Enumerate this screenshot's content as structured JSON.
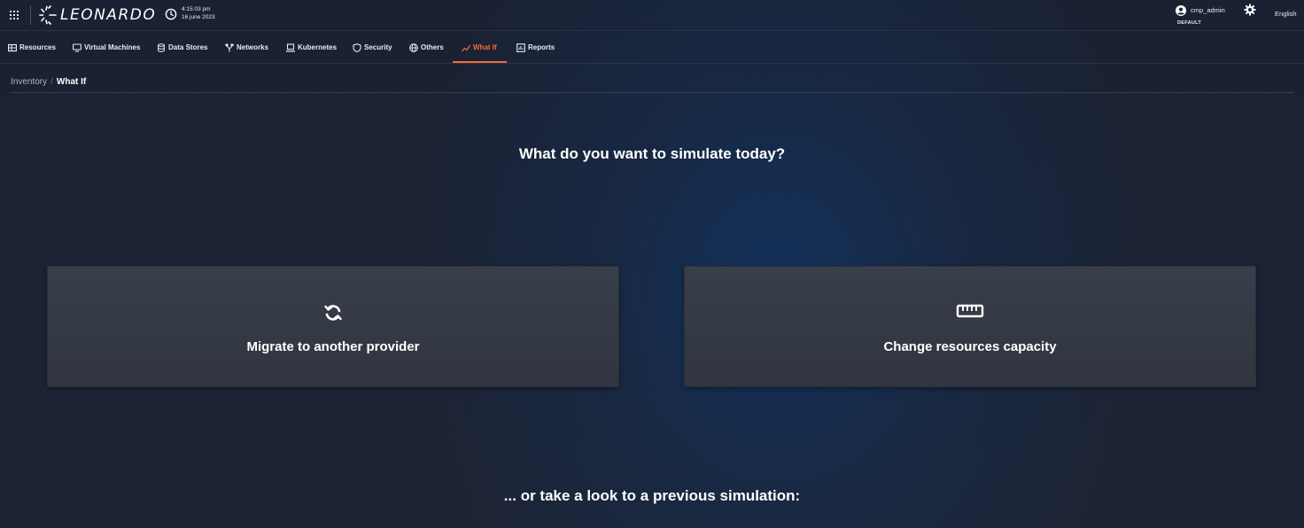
{
  "header": {
    "logo_text": "LEONARDO",
    "time": "4:15:03 pm",
    "date": "16 june 2023",
    "user_name": "cmp_admin",
    "tenant": "DEFAULT",
    "language": "English"
  },
  "nav": {
    "items": [
      {
        "label": "Resources",
        "icon": "server-icon"
      },
      {
        "label": "Virtual Machines",
        "icon": "monitor-icon"
      },
      {
        "label": "Data Stores",
        "icon": "database-icon"
      },
      {
        "label": "Networks",
        "icon": "network-icon"
      },
      {
        "label": "Kubernetes",
        "icon": "laptop-icon"
      },
      {
        "label": "Security",
        "icon": "shield-icon"
      },
      {
        "label": "Others",
        "icon": "globe-icon"
      },
      {
        "label": "What If",
        "icon": "chart-line-icon"
      },
      {
        "label": "Reports",
        "icon": "report-icon"
      }
    ],
    "active": "What If",
    "accent_color": "#f26b38"
  },
  "breadcrumb": {
    "parent": "Inventory",
    "separator": "/",
    "current": "What If"
  },
  "main": {
    "question": "What do you want to simulate today?",
    "cards": [
      {
        "label": "Migrate to another provider",
        "icon": "sync-icon"
      },
      {
        "label": "Change resources capacity",
        "icon": "ruler-icon"
      }
    ],
    "previous_heading": "... or take a look to a previous simulation:"
  }
}
